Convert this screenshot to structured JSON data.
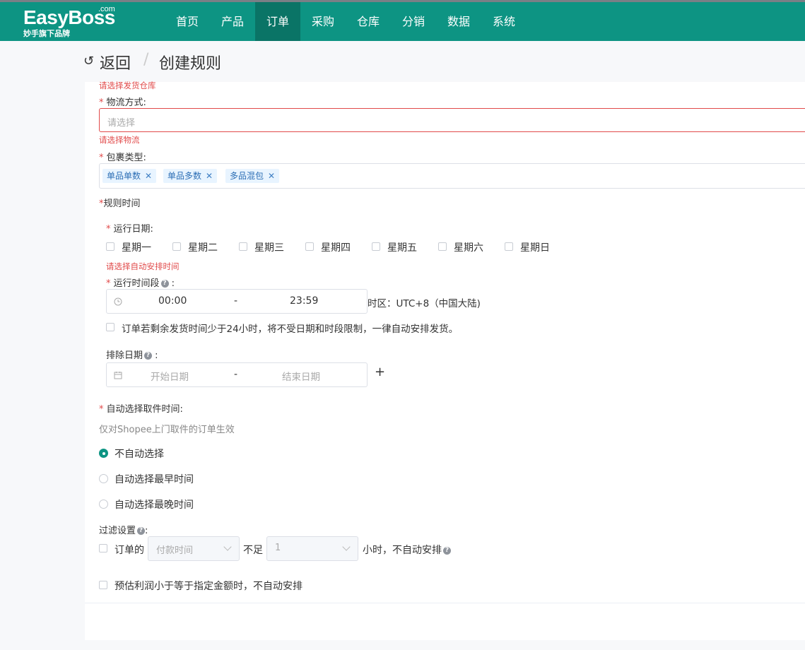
{
  "app": {
    "logo_main": "EasyBoss",
    "logo_com": ".com",
    "logo_sub": "妙手旗下品牌",
    "nav": [
      "首页",
      "产品",
      "订单",
      "采购",
      "仓库",
      "分销",
      "数据",
      "系统"
    ],
    "active_nav": "订单",
    "brand_color": "#0d9483"
  },
  "header": {
    "back": "返回",
    "sep": "/",
    "title": "创建规则"
  },
  "form": {
    "warehouse_error": "请选择发货仓库",
    "logistics_label": "物流方式:",
    "logistics_placeholder": "请选择",
    "logistics_error": "请选择物流",
    "package_label": "包裹类型:",
    "package_tags": [
      "单品单数",
      "单品多数",
      "多品混包"
    ],
    "rule_time_label": "规则时间",
    "run_date_label": "运行日期:",
    "weekdays": [
      "星期一",
      "星期二",
      "星期三",
      "星期四",
      "星期五",
      "星期六",
      "星期日"
    ],
    "run_date_error": "请选择自动安排时间",
    "run_period_label": "运行时间段",
    "run_period_colon": ":",
    "time_start": "00:00",
    "time_dash": "-",
    "time_end": "23:59",
    "timezone": "时区：UTC+8（中国大陆)",
    "under24_text": "订单若剩余发货时间少于24小时，将不受日期和时段限制，一律自动安排发货。",
    "exclude_label": "排除日期",
    "exclude_colon": ":",
    "start_date_ph": "开始日期",
    "end_date_ph": "结束日期",
    "plus": "+",
    "pickup_label": "自动选择取件时间:",
    "pickup_hint": "仅对Shopee上门取件的订单生效",
    "pickup_options": [
      "不自动选择",
      "自动选择最早时间",
      "自动选择最晚时间"
    ],
    "pickup_selected": "不自动选择",
    "filter_label": "过滤设置",
    "filter_colon": ":",
    "filter_order_prefix": "订单的",
    "filter_time_field": "付款时间",
    "filter_mid": "不足",
    "filter_hours": "1",
    "filter_suffix": "小时，不自动安排",
    "profit_text": "预估利润小于等于指定金额时，不自动安排"
  }
}
